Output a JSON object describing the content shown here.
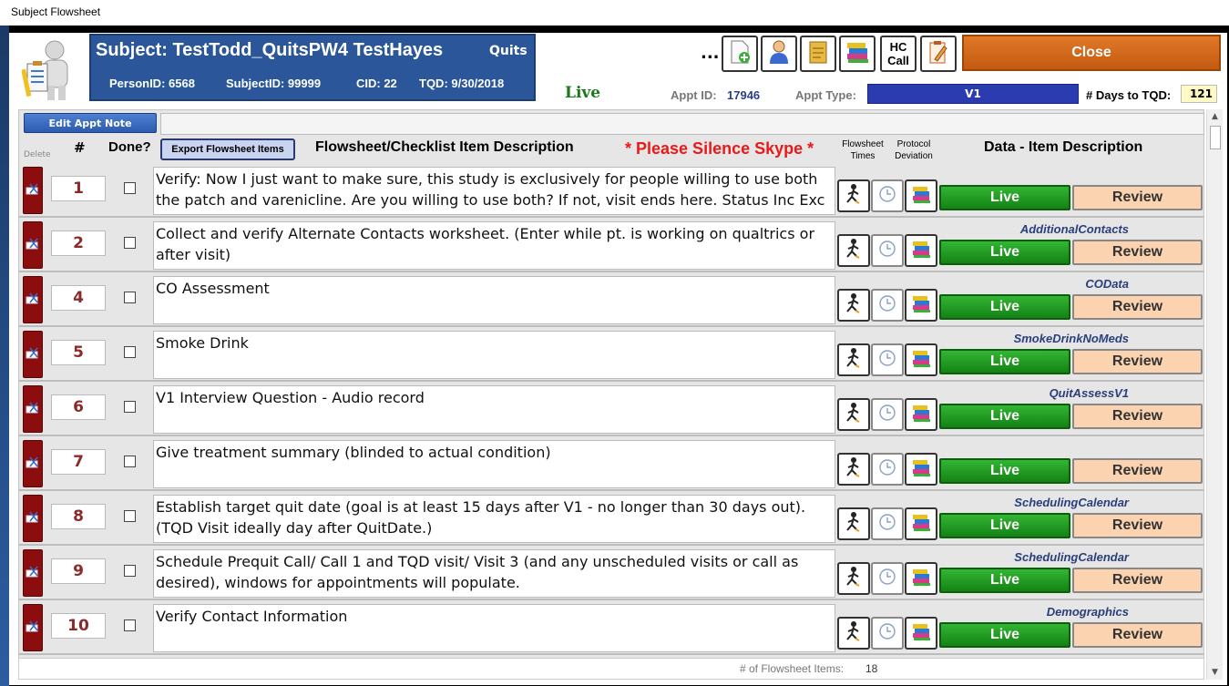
{
  "window": {
    "title": "Subject Flowsheet"
  },
  "subject": {
    "title": "Subject: TestTodd_QuitsPW4 TestHayes",
    "study": "Quits",
    "person_id": "PersonID: 6568",
    "subject_id": "SubjectID: 99999",
    "cid": "CID: 22",
    "tqd": "TQD: 9/30/2018"
  },
  "status": {
    "live": "Live"
  },
  "toolbar": {
    "ellipsis": "...",
    "hc_call_line1": "HC",
    "hc_call_line2": "Call",
    "close_label": "Close",
    "icons": [
      "add-document-icon",
      "person-icon",
      "notes-icon",
      "books-icon",
      "hc-call",
      "clipboard-edit-icon"
    ]
  },
  "appointment": {
    "appt_id_label": "Appt ID:",
    "appt_id_value": "17946",
    "appt_type_label": "Appt Type:",
    "appt_type_value": "V1",
    "days_label": "# Days to TQD:",
    "days_value": "121"
  },
  "list": {
    "edit_appt_note": "Edit Appt Note",
    "delete_header": "Delete",
    "num_header": "#",
    "done_header": "Done?",
    "export_label": "Export Flowsheet Items",
    "desc_header": "Flowsheet/Checklist Item Description",
    "skype_warning": "* Please Silence Skype *",
    "flowsheet_times_header": "Flowsheet Times",
    "protocol_deviation_header": "Protocol Deviation",
    "data_header": "Data - Item Description",
    "live_label": "Live",
    "review_label": "Review",
    "rows": [
      {
        "num": "1",
        "desc": "Verify: Now I just want to make sure, this study is exclusively for people willing to use both the patch and varenicline. Are you willing to use both? If not, visit ends here. Status Inc Exc Fail",
        "data": ""
      },
      {
        "num": "2",
        "desc": "Collect and verify Alternate Contacts worksheet. (Enter while pt. is working on qualtrics or after visit)",
        "data": "AdditionalContacts"
      },
      {
        "num": "4",
        "desc": "CO Assessment",
        "data": "COData"
      },
      {
        "num": "5",
        "desc": "Smoke Drink",
        "data": "SmokeDrinkNoMeds"
      },
      {
        "num": "6",
        "desc": "V1 Interview Question - Audio record",
        "data": "QuitAssessV1"
      },
      {
        "num": "7",
        "desc": "Give treatment summary (blinded to actual condition)",
        "data": ""
      },
      {
        "num": "8",
        "desc": "Establish target quit date (goal is at least 15 days after V1 - no longer than 30 days out). (TQD Visit ideally day after QuitDate.)",
        "data": "SchedulingCalendar"
      },
      {
        "num": "9",
        "desc": "Schedule Prequit Call/ Call 1 and TQD visit/ Visit 3 (and any unscheduled visits or call as desired), windows for appointments will populate.",
        "data": "SchedulingCalendar"
      },
      {
        "num": "10",
        "desc": "Verify Contact Information",
        "data": "Demographics"
      }
    ],
    "footer_label": "# of Flowsheet Items:",
    "footer_count": "18"
  },
  "colors": {
    "header_blue": "#2b579a",
    "close_orange": "#d46a1c",
    "live_green": "#1a9a1a",
    "review_peach": "#fcd3b0",
    "delete_red": "#8b0d0d",
    "skype_red": "#e81a1a"
  }
}
